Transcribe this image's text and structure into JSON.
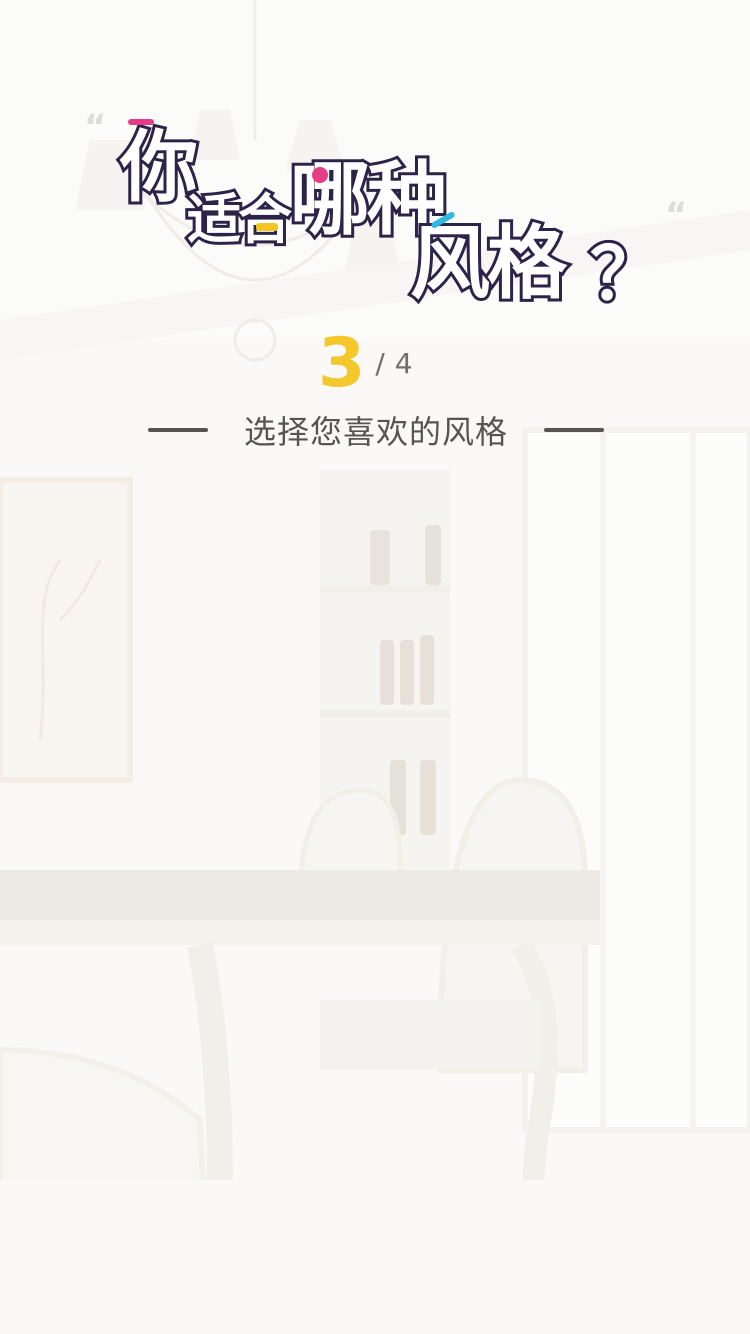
{
  "title": {
    "part1": "你",
    "part2": "适合",
    "part3": "哪种",
    "part4": "风格",
    "part5": "？"
  },
  "quote_mark": "“",
  "progress": {
    "current": "3",
    "separator": "/",
    "total": "4"
  },
  "subtitle": "选择您喜欢的风格",
  "colors": {
    "accent_yellow": "#f4c72a",
    "accent_pink": "#e63b85",
    "accent_cyan": "#2fb8e3",
    "title_outline": "#2b2348",
    "text_gray": "#555555"
  }
}
